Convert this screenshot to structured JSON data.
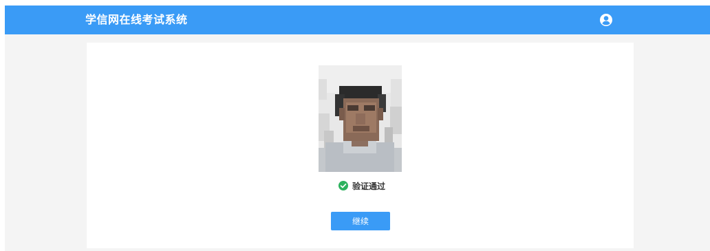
{
  "header": {
    "title": "学信网在线考试系统",
    "user_icon": "user-circle-icon"
  },
  "photo": {
    "icon": "face-photo"
  },
  "verification": {
    "icon": "check-circle-icon",
    "status_text": "验证通过",
    "icon_color": "#2db25e"
  },
  "actions": {
    "continue_label": "继续"
  },
  "colors": {
    "primary": "#3a9bf6",
    "background": "#f4f4f4",
    "card": "#ffffff",
    "text": "#333333"
  }
}
